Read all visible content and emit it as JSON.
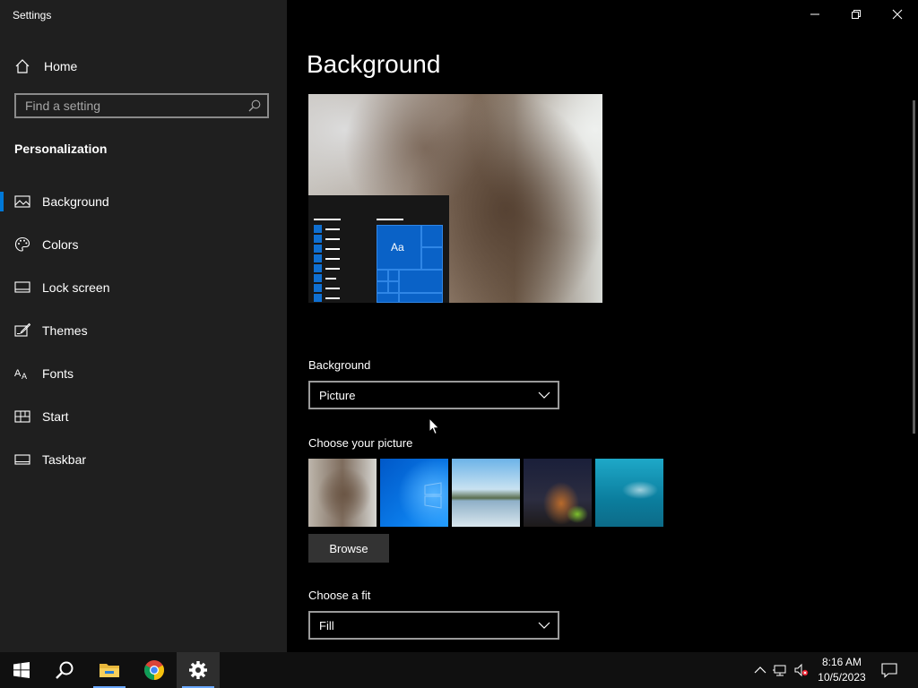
{
  "window": {
    "title": "Settings"
  },
  "sidebar": {
    "home_label": "Home",
    "search_placeholder": "Find a setting",
    "section_title": "Personalization",
    "items": [
      {
        "label": "Background",
        "icon": "picture-icon",
        "active": true
      },
      {
        "label": "Colors",
        "icon": "palette-icon",
        "active": false
      },
      {
        "label": "Lock screen",
        "icon": "lock-screen-icon",
        "active": false
      },
      {
        "label": "Themes",
        "icon": "brush-icon",
        "active": false
      },
      {
        "label": "Fonts",
        "icon": "font-icon",
        "active": false
      },
      {
        "label": "Start",
        "icon": "start-tiles-icon",
        "active": false
      },
      {
        "label": "Taskbar",
        "icon": "taskbar-icon",
        "active": false
      }
    ]
  },
  "main": {
    "page_title": "Background",
    "preview": {
      "tile_text": "Aa"
    },
    "background_label": "Background",
    "background_value": "Picture",
    "choose_picture_label": "Choose your picture",
    "browse_label": "Browse",
    "fit_label": "Choose a fit",
    "fit_value": "Fill"
  },
  "taskbar": {
    "apps": [
      "start-icon",
      "search-icon",
      "file-explorer-icon",
      "chrome-icon",
      "settings-icon"
    ],
    "time": "8:16 AM",
    "date": "10/5/2023"
  },
  "colors": {
    "accent": "#0078d7",
    "sidebar": "#1f1f1f",
    "taskbar": "#101010"
  }
}
